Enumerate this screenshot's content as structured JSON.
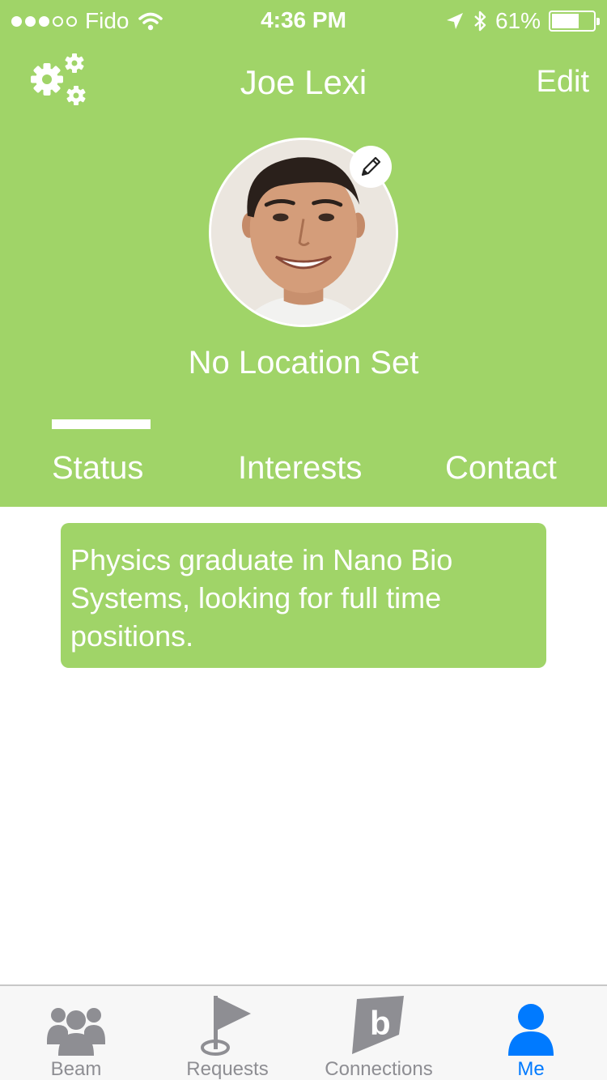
{
  "status_bar": {
    "carrier": "Fido",
    "time": "4:36 PM",
    "battery": "61%",
    "signal_bars_filled": 3,
    "signal_bars_total": 5
  },
  "nav": {
    "title": "Joe Lexi",
    "edit_label": "Edit"
  },
  "profile": {
    "location": "No Location Set"
  },
  "tabs": [
    {
      "label": "Status",
      "active": true
    },
    {
      "label": "Interests",
      "active": false
    },
    {
      "label": "Contact",
      "active": false
    }
  ],
  "status_text": "Physics graduate in Nano Bio Systems, looking for full time positions.",
  "tab_bar": [
    {
      "label": "Beam",
      "icon": "group-icon",
      "active": false
    },
    {
      "label": "Requests",
      "icon": "flag-icon",
      "active": false
    },
    {
      "label": "Connections",
      "icon": "b-logo-icon",
      "active": false
    },
    {
      "label": "Me",
      "icon": "person-icon",
      "active": true
    }
  ],
  "colors": {
    "brand_green": "#a0d468",
    "active_blue": "#007aff",
    "inactive_gray": "#8e8e93"
  }
}
